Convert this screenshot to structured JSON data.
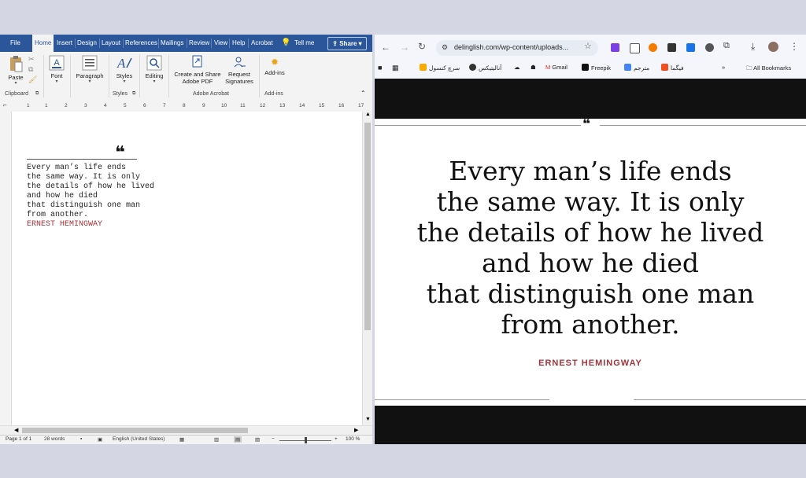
{
  "word": {
    "tabs": [
      "File",
      "Home",
      "Insert",
      "Design",
      "Layout",
      "References",
      "Mailings",
      "Review",
      "View",
      "Help",
      "Acrobat"
    ],
    "tell_me": "Tell me",
    "share": "Share",
    "ribbon": {
      "paste": "Paste",
      "font": "Font",
      "paragraph": "Paragraph",
      "styles": "Styles",
      "editing": "Editing",
      "create_share_pdf": [
        "Create and Share",
        "Adobe PDF"
      ],
      "request_signatures": [
        "Request",
        "Signatures"
      ],
      "addins": "Add-ins",
      "groups": {
        "clipboard": "Clipboard",
        "styles": "Styles",
        "adobe": "Adobe Acrobat",
        "addins": "Add-ins"
      }
    },
    "ruler_ticks": [
      "1",
      "1",
      "2",
      "3",
      "4",
      "5",
      "6",
      "7",
      "8",
      "9",
      "10",
      "11",
      "12",
      "13",
      "14",
      "15",
      "16",
      "17"
    ],
    "quote_mark": "❝",
    "doc_lines": [
      "Every man’s life ends",
      "the same way. It is only",
      "the details of how he lived",
      "and how he died",
      "that distinguish one man",
      "from another."
    ],
    "author": "ERNEST HEMINGWAY",
    "status": {
      "page": "Page 1 of 1",
      "words": "28 words",
      "language": "English (United States)",
      "zoom": "100 %"
    }
  },
  "browser": {
    "url": "delinglish.com/wp-content/uploads...",
    "bookmarks": [
      "سرچ کنسول",
      "آنالیتیکس",
      "Gmail",
      "Freepik",
      "مترجم",
      "فیگما"
    ],
    "all_bookmarks": "All Bookmarks",
    "quote_mark": "❝",
    "quote_lines": [
      "Every man’s life ends",
      "the same way. It is only",
      "the details of how he lived",
      "and how he died",
      "that distinguish one man",
      "from another."
    ],
    "author": "ERNEST HEMINGWAY"
  },
  "colors": {
    "word_blue": "#2b579a",
    "author_red": "#a3333a",
    "chrome_bg": "#f4f6fc"
  }
}
